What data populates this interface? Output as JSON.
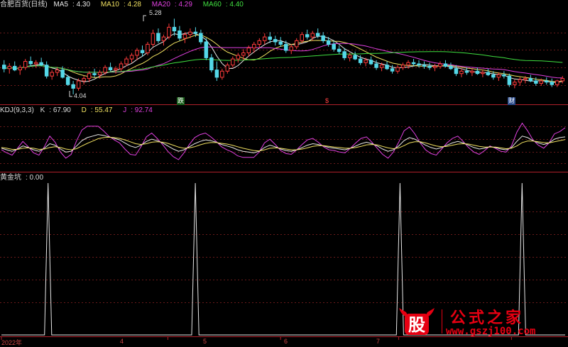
{
  "chart_data": [
    {
      "type": "candlestick",
      "panel": "main",
      "title": "合肥百货(日线)",
      "indicators": [
        {
          "name": "MA5",
          "value": "4.30",
          "color": "#e8e8e8"
        },
        {
          "name": "MA10",
          "value": "4.28",
          "color": "#f0e060"
        },
        {
          "name": "MA20",
          "value": "4.29",
          "color": "#e040e0"
        },
        {
          "name": "MA60",
          "value": "4.40",
          "color": "#40e040"
        }
      ],
      "annotations": {
        "high": "5.28",
        "low": "4.04"
      },
      "markers": [
        "跌",
        "$",
        "财"
      ],
      "ylim": [
        3.9,
        5.4
      ],
      "ohlc": [
        [
          4.52,
          4.6,
          4.4,
          4.46
        ],
        [
          4.46,
          4.55,
          4.38,
          4.5
        ],
        [
          4.5,
          4.58,
          4.42,
          4.44
        ],
        [
          4.44,
          4.52,
          4.36,
          4.48
        ],
        [
          4.48,
          4.62,
          4.44,
          4.58
        ],
        [
          4.58,
          4.66,
          4.5,
          4.54
        ],
        [
          4.54,
          4.6,
          4.48,
          4.56
        ],
        [
          4.56,
          4.64,
          4.5,
          4.52
        ],
        [
          4.52,
          4.58,
          4.3,
          4.34
        ],
        [
          4.34,
          4.44,
          4.28,
          4.4
        ],
        [
          4.4,
          4.48,
          4.34,
          4.44
        ],
        [
          4.44,
          4.5,
          4.3,
          4.32
        ],
        [
          4.32,
          4.36,
          4.18,
          4.2
        ],
        [
          4.2,
          4.26,
          4.04,
          4.14
        ],
        [
          4.14,
          4.3,
          4.1,
          4.26
        ],
        [
          4.26,
          4.34,
          4.2,
          4.3
        ],
        [
          4.3,
          4.42,
          4.24,
          4.38
        ],
        [
          4.38,
          4.46,
          4.32,
          4.36
        ],
        [
          4.36,
          4.44,
          4.3,
          4.4
        ],
        [
          4.4,
          4.52,
          4.36,
          4.48
        ],
        [
          4.48,
          4.56,
          4.42,
          4.44
        ],
        [
          4.44,
          4.5,
          4.38,
          4.46
        ],
        [
          4.46,
          4.58,
          4.42,
          4.54
        ],
        [
          4.54,
          4.66,
          4.5,
          4.62
        ],
        [
          4.62,
          4.72,
          4.56,
          4.68
        ],
        [
          4.68,
          4.8,
          4.6,
          4.76
        ],
        [
          4.76,
          4.84,
          4.66,
          4.72
        ],
        [
          4.72,
          4.9,
          4.68,
          4.86
        ],
        [
          4.86,
          5.1,
          4.82,
          5.04
        ],
        [
          5.04,
          5.12,
          4.88,
          4.92
        ],
        [
          4.92,
          5.02,
          4.84,
          4.98
        ],
        [
          4.98,
          5.2,
          4.94,
          5.14
        ],
        [
          5.14,
          5.28,
          5.0,
          5.08
        ],
        [
          5.08,
          5.16,
          4.92,
          4.96
        ],
        [
          4.96,
          5.06,
          4.88,
          5.02
        ],
        [
          5.02,
          5.12,
          4.96,
          5.06
        ],
        [
          5.06,
          5.14,
          4.98,
          5.04
        ],
        [
          5.04,
          5.1,
          4.86,
          4.9
        ],
        [
          4.9,
          4.96,
          4.6,
          4.64
        ],
        [
          4.64,
          4.7,
          4.4,
          4.44
        ],
        [
          4.44,
          4.58,
          4.26,
          4.32
        ],
        [
          4.32,
          4.46,
          4.28,
          4.42
        ],
        [
          4.42,
          4.56,
          4.38,
          4.52
        ],
        [
          4.52,
          4.66,
          4.48,
          4.62
        ],
        [
          4.62,
          4.72,
          4.56,
          4.68
        ],
        [
          4.68,
          4.78,
          4.6,
          4.72
        ],
        [
          4.72,
          4.84,
          4.66,
          4.8
        ],
        [
          4.8,
          4.9,
          4.72,
          4.86
        ],
        [
          4.86,
          4.96,
          4.8,
          4.92
        ],
        [
          4.92,
          5.04,
          4.86,
          4.98
        ],
        [
          4.98,
          5.06,
          4.88,
          4.94
        ],
        [
          4.94,
          5.0,
          4.84,
          4.9
        ],
        [
          4.9,
          4.98,
          4.82,
          4.86
        ],
        [
          4.86,
          4.92,
          4.72,
          4.76
        ],
        [
          4.76,
          4.86,
          4.7,
          4.82
        ],
        [
          4.82,
          4.96,
          4.78,
          4.92
        ],
        [
          4.92,
          5.06,
          4.88,
          5.02
        ],
        [
          5.02,
          5.1,
          4.94,
          4.98
        ],
        [
          4.98,
          5.08,
          4.92,
          5.04
        ],
        [
          5.04,
          5.12,
          4.96,
          5.0
        ],
        [
          5.0,
          5.06,
          4.88,
          4.92
        ],
        [
          4.92,
          4.98,
          4.82,
          4.86
        ],
        [
          4.86,
          4.92,
          4.74,
          4.78
        ],
        [
          4.78,
          4.84,
          4.7,
          4.74
        ],
        [
          4.74,
          4.8,
          4.6,
          4.64
        ],
        [
          4.64,
          4.72,
          4.58,
          4.68
        ],
        [
          4.68,
          4.74,
          4.6,
          4.62
        ],
        [
          4.62,
          4.68,
          4.52,
          4.56
        ],
        [
          4.56,
          4.64,
          4.5,
          4.6
        ],
        [
          4.6,
          4.66,
          4.52,
          4.54
        ],
        [
          4.54,
          4.6,
          4.44,
          4.48
        ],
        [
          4.48,
          4.56,
          4.42,
          4.52
        ],
        [
          4.52,
          4.58,
          4.44,
          4.46
        ],
        [
          4.46,
          4.52,
          4.38,
          4.42
        ],
        [
          4.42,
          4.52,
          4.38,
          4.48
        ],
        [
          4.48,
          4.56,
          4.44,
          4.52
        ],
        [
          4.52,
          4.6,
          4.46,
          4.56
        ],
        [
          4.56,
          4.62,
          4.5,
          4.54
        ],
        [
          4.54,
          4.6,
          4.48,
          4.52
        ],
        [
          4.52,
          4.58,
          4.46,
          4.5
        ],
        [
          4.5,
          4.56,
          4.44,
          4.48
        ],
        [
          4.48,
          4.54,
          4.42,
          4.5
        ],
        [
          4.5,
          4.58,
          4.46,
          4.54
        ],
        [
          4.54,
          4.6,
          4.48,
          4.5
        ],
        [
          4.5,
          4.56,
          4.44,
          4.46
        ],
        [
          4.46,
          4.52,
          4.34,
          4.38
        ],
        [
          4.38,
          4.46,
          4.32,
          4.42
        ],
        [
          4.42,
          4.48,
          4.36,
          4.4
        ],
        [
          4.4,
          4.46,
          4.34,
          4.42
        ],
        [
          4.42,
          4.48,
          4.36,
          4.38
        ],
        [
          4.38,
          4.44,
          4.32,
          4.4
        ],
        [
          4.4,
          4.46,
          4.34,
          4.36
        ],
        [
          4.36,
          4.42,
          4.28,
          4.32
        ],
        [
          4.32,
          4.4,
          4.26,
          4.36
        ],
        [
          4.36,
          4.42,
          4.3,
          4.34
        ],
        [
          4.34,
          4.38,
          4.16,
          4.2
        ],
        [
          4.2,
          4.28,
          4.14,
          4.24
        ],
        [
          4.24,
          4.32,
          4.18,
          4.28
        ],
        [
          4.28,
          4.34,
          4.22,
          4.3
        ],
        [
          4.3,
          4.36,
          4.24,
          4.26
        ],
        [
          4.26,
          4.32,
          4.18,
          4.22
        ],
        [
          4.22,
          4.3,
          4.18,
          4.26
        ],
        [
          4.26,
          4.32,
          4.2,
          4.24
        ],
        [
          4.24,
          4.3,
          4.16,
          4.2
        ],
        [
          4.2,
          4.28,
          4.16,
          4.26
        ],
        [
          4.26,
          4.34,
          4.22,
          4.3
        ]
      ]
    },
    {
      "type": "line",
      "panel": "kdj",
      "title": "KDJ(9,3,3)",
      "readouts": [
        {
          "name": "K",
          "value": "67.90"
        },
        {
          "name": "D",
          "value": "55.47"
        },
        {
          "name": "J",
          "value": "92.74"
        }
      ],
      "ylim": [
        -20,
        120
      ],
      "series": [
        {
          "name": "K",
          "color": "#e8e8e8",
          "values": [
            38,
            34,
            30,
            36,
            44,
            40,
            34,
            30,
            38,
            50,
            46,
            36,
            28,
            30,
            44,
            58,
            66,
            70,
            74,
            72,
            68,
            64,
            60,
            52,
            44,
            40,
            46,
            56,
            62,
            58,
            52,
            44,
            36,
            30,
            34,
            42,
            50,
            56,
            60,
            58,
            54,
            48,
            44,
            40,
            34,
            30,
            28,
            26,
            30,
            40,
            46,
            42,
            36,
            32,
            30,
            34,
            40,
            46,
            50,
            48,
            44,
            40,
            38,
            36,
            34,
            38,
            44,
            50,
            54,
            50,
            44,
            36,
            30,
            34,
            44,
            58,
            66,
            62,
            54,
            46,
            40,
            36,
            40,
            46,
            52,
            56,
            52,
            46,
            40,
            36,
            38,
            42,
            40,
            36,
            34,
            40,
            56,
            70,
            66,
            58,
            52,
            48,
            52,
            62,
            66,
            68
          ]
        },
        {
          "name": "D",
          "color": "#f0e060",
          "values": [
            40,
            38,
            35,
            35,
            38,
            39,
            38,
            35,
            36,
            40,
            42,
            40,
            36,
            34,
            37,
            44,
            51,
            57,
            63,
            66,
            67,
            66,
            64,
            60,
            55,
            50,
            48,
            50,
            54,
            55,
            54,
            51,
            46,
            41,
            38,
            39,
            42,
            47,
            51,
            53,
            53,
            51,
            49,
            46,
            42,
            38,
            35,
            32,
            31,
            34,
            38,
            39,
            38,
            36,
            34,
            34,
            36,
            39,
            43,
            45,
            45,
            43,
            41,
            40,
            38,
            38,
            40,
            43,
            47,
            48,
            47,
            43,
            39,
            37,
            39,
            45,
            52,
            55,
            55,
            52,
            48,
            44,
            42,
            43,
            46,
            49,
            50,
            49,
            46,
            43,
            41,
            41,
            41,
            39,
            37,
            38,
            44,
            53,
            57,
            57,
            55,
            53,
            52,
            55,
            58,
            61
          ]
        },
        {
          "name": "J",
          "color": "#e040e0",
          "values": [
            34,
            26,
            20,
            38,
            56,
            42,
            26,
            20,
            42,
            70,
            54,
            28,
            12,
            22,
            58,
            86,
            96,
            96,
            96,
            84,
            70,
            60,
            52,
            36,
            22,
            20,
            42,
            68,
            78,
            64,
            48,
            30,
            16,
            8,
            26,
            48,
            66,
            74,
            78,
            68,
            56,
            42,
            34,
            28,
            18,
            14,
            14,
            14,
            28,
            52,
            62,
            48,
            32,
            24,
            22,
            34,
            48,
            60,
            64,
            54,
            42,
            34,
            32,
            28,
            26,
            38,
            52,
            64,
            68,
            54,
            38,
            22,
            12,
            28,
            54,
            84,
            94,
            76,
            52,
            34,
            24,
            20,
            36,
            52,
            64,
            70,
            56,
            40,
            28,
            22,
            32,
            44,
            38,
            30,
            28,
            44,
            80,
            104,
            84,
            60,
            46,
            38,
            52,
            76,
            82,
            92
          ]
        }
      ]
    },
    {
      "type": "line",
      "panel": "signal",
      "title": "黄金坑",
      "readout": ": 0.00",
      "ylim": [
        0,
        1
      ],
      "spikes": [
        13,
        54,
        111,
        145
      ],
      "n": 158
    }
  ],
  "x_axis": {
    "labels": [
      {
        "text": "2022年",
        "index": 0
      },
      {
        "text": "4",
        "index": 31
      },
      {
        "text": "5",
        "index": 52
      },
      {
        "text": "6",
        "index": 74
      },
      {
        "text": "7",
        "index": 95
      }
    ]
  },
  "watermark": {
    "title": "公式之家",
    "url": "www.gszj100.com"
  }
}
